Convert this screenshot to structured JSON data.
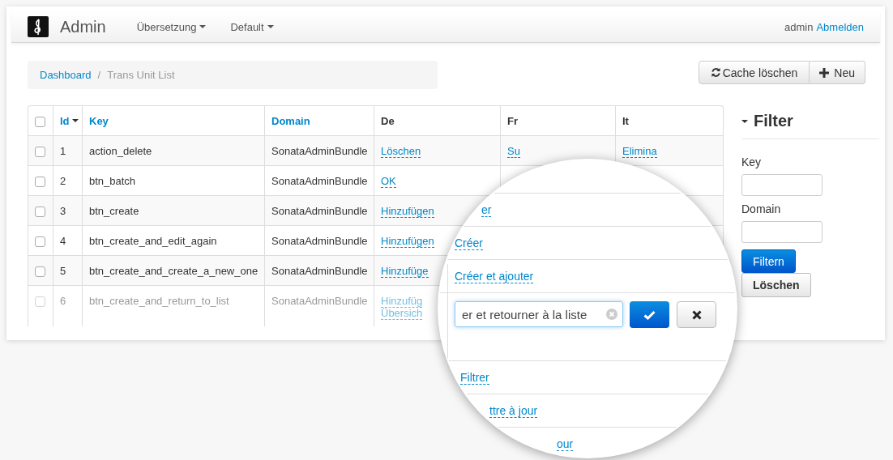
{
  "navbar": {
    "brand": "Admin",
    "menus": [
      {
        "label": "Übersetzung"
      },
      {
        "label": "Default"
      }
    ],
    "user": "admin",
    "logout": "Abmelden"
  },
  "breadcrumb": {
    "separator": "/",
    "items": [
      {
        "label": "Dashboard",
        "kind": "link"
      },
      {
        "label": "Trans Unit List",
        "kind": "current"
      }
    ]
  },
  "actions": [
    {
      "label": "Cache löschen"
    },
    {
      "label": "Neu"
    }
  ],
  "table": {
    "header_checked": false,
    "columns": [
      {
        "label": "Id",
        "kind": "sorted"
      },
      {
        "label": "Key",
        "kind": "sortable"
      },
      {
        "label": "Domain",
        "kind": "sortable"
      },
      {
        "label": "De",
        "kind": "plain"
      },
      {
        "label": "Fr",
        "kind": "plain"
      },
      {
        "label": "It",
        "kind": "plain"
      }
    ],
    "rows": [
      {
        "checked": false,
        "dimmed": false,
        "id": "1",
        "key": "action_delete",
        "domain": "SonataAdminBundle",
        "de": [
          "Löschen"
        ],
        "fr": [
          "Su"
        ],
        "it": [
          "Elimina"
        ]
      },
      {
        "checked": false,
        "dimmed": false,
        "id": "2",
        "key": "btn_batch",
        "domain": "SonataAdminBundle",
        "de": [
          "OK"
        ],
        "fr": [],
        "it": []
      },
      {
        "checked": false,
        "dimmed": false,
        "id": "3",
        "key": "btn_create",
        "domain": "SonataAdminBundle",
        "de": [
          "Hinzufügen"
        ],
        "fr": [],
        "it": []
      },
      {
        "checked": false,
        "dimmed": false,
        "id": "4",
        "key": "btn_create_and_edit_again",
        "domain": "SonataAdminBundle",
        "de": [
          "Hinzufügen"
        ],
        "fr": [],
        "it": []
      },
      {
        "checked": false,
        "dimmed": false,
        "id": "5",
        "key": "btn_create_and_create_a_new_one",
        "domain": "SonataAdminBundle",
        "de": [
          "Hinzufüge"
        ],
        "fr": [],
        "it": []
      },
      {
        "checked": false,
        "dimmed": true,
        "id": "6",
        "key": "btn_create_and_return_to_list",
        "domain": "SonataAdminBundle",
        "de": [
          "Hinzufüg",
          "Übersich"
        ],
        "fr": [],
        "it": []
      }
    ]
  },
  "magnifier": {
    "rows": [
      {
        "kind": "link",
        "text": "er"
      },
      {
        "kind": "link",
        "text": "Créer"
      },
      {
        "kind": "link",
        "text": "Créer et ajouter"
      },
      {
        "kind": "edit",
        "value": "er et retourner à la liste"
      },
      {
        "kind": "link",
        "text": "Filtrer"
      },
      {
        "kind": "link",
        "text": "ttre à jour"
      },
      {
        "kind": "link",
        "text": "our"
      }
    ]
  },
  "filter": {
    "title": "Filter",
    "expanded": true,
    "fields": [
      {
        "label": "Key"
      },
      {
        "label": "Domain"
      }
    ],
    "buttons": [
      {
        "label": "Filtern",
        "primary": true
      },
      {
        "label": "Löschen",
        "primary": false
      }
    ]
  }
}
